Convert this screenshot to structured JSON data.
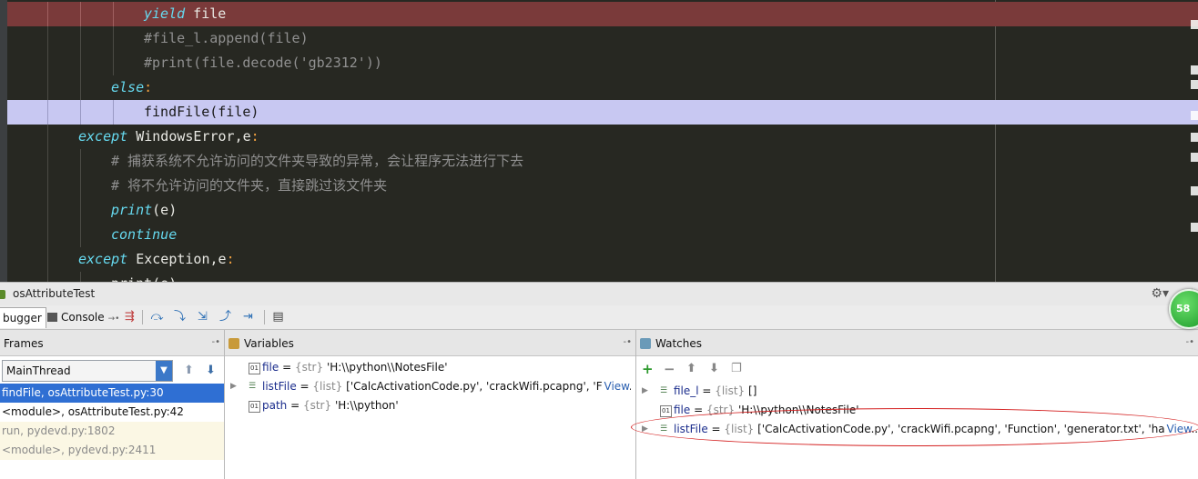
{
  "editor": {
    "lines": [
      {
        "parts": [
          {
            "t": "yield",
            "c": "kw"
          },
          {
            "t": " file",
            "c": ""
          }
        ]
      },
      {
        "parts": [
          {
            "t": "#file_l.append(file)",
            "c": "cm"
          }
        ]
      },
      {
        "parts": [
          {
            "t": "#print(file.decode('gb2312'))",
            "c": "cm"
          }
        ]
      },
      {
        "parts": [
          {
            "t": "else",
            "c": "kw"
          },
          {
            "t": ":",
            "c": "punc"
          }
        ]
      },
      {
        "parts": [
          {
            "t": "findFile(file)",
            "c": "fn"
          }
        ]
      },
      {
        "parts": [
          {
            "t": "except",
            "c": "kw"
          },
          {
            "t": " WindowsError,e",
            "c": ""
          },
          {
            "t": ":",
            "c": "punc"
          }
        ]
      },
      {
        "parts": [
          {
            "t": "# 捕获系统不允许访问的文件夹导致的异常，会让程序无法进行下去",
            "c": "cm"
          }
        ]
      },
      {
        "parts": [
          {
            "t": "# 将不允许访问的文件夹，直接跳过该文件夹",
            "c": "cm"
          }
        ]
      },
      {
        "parts": [
          {
            "t": "print",
            "c": "kw"
          },
          {
            "t": "(e)",
            "c": ""
          }
        ]
      },
      {
        "parts": [
          {
            "t": "continue",
            "c": "kw"
          }
        ]
      },
      {
        "parts": [
          {
            "t": "except",
            "c": "kw"
          },
          {
            "t": " Exception,e",
            "c": ""
          },
          {
            "t": ":",
            "c": "punc"
          }
        ]
      },
      {
        "parts": [
          {
            "t": "print(e)",
            "c": ""
          }
        ]
      }
    ]
  },
  "debugger": {
    "title": "osAttributeTest",
    "badge": "58",
    "tabs": {
      "debugger": "bugger",
      "console": "Console"
    }
  },
  "frames": {
    "title": "Frames",
    "thread": "MainThread",
    "items": [
      {
        "label": "findFile, osAttributeTest.py:30",
        "state": "selected"
      },
      {
        "label": "<module>, osAttributeTest.py:42",
        "state": "normal"
      },
      {
        "label": "run, pydevd.py:1802",
        "state": "library"
      },
      {
        "label": "<module>, pydevd.py:2411",
        "state": "library"
      }
    ]
  },
  "variables": {
    "title": "Variables",
    "items": [
      {
        "name": "file",
        "type": "{str}",
        "value": "'H:\\\\python\\\\NotesFile'",
        "expandable": false,
        "kind": "str"
      },
      {
        "name": "listFile",
        "type": "{list}",
        "value": "['CalcActivationCode.py', 'crackWifi.pcapng', 'Func...",
        "expandable": true,
        "kind": "list",
        "view": "View"
      },
      {
        "name": "path",
        "type": "{str}",
        "value": "'H:\\\\python'",
        "expandable": false,
        "kind": "str"
      }
    ]
  },
  "watches": {
    "title": "Watches",
    "items": [
      {
        "name": "file_l",
        "type": "{list}",
        "value": "[]",
        "expandable": true,
        "kind": "list"
      },
      {
        "name": "file",
        "type": "{str}",
        "value": "'H:\\\\python\\\\NotesFile'",
        "expandable": false,
        "kind": "str"
      },
      {
        "name": "listFile",
        "type": "{list}",
        "value": "['CalcActivationCode.py', 'crackWifi.pcapng', 'Function', 'generator.txt', 'hack-hi...",
        "expandable": true,
        "kind": "list",
        "view": "View"
      }
    ]
  },
  "colors": {
    "editor_bg": "#272822",
    "error_line": "#7a3a3a",
    "current_line": "#c8c8f2",
    "selection": "#2f6fd3",
    "annotation": "#d42020"
  }
}
